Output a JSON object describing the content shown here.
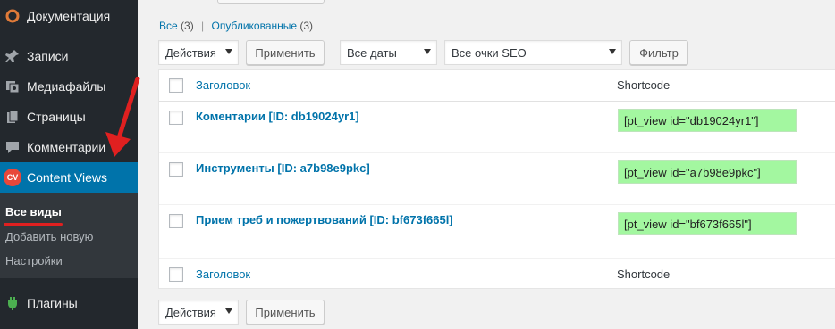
{
  "sidebar": {
    "items": [
      {
        "label": "Документация",
        "icon": "docs-logo-icon"
      },
      {
        "label": "Записи",
        "icon": "pin-icon"
      },
      {
        "label": "Медиафайлы",
        "icon": "media-icon"
      },
      {
        "label": "Страницы",
        "icon": "pages-icon"
      },
      {
        "label": "Комментарии",
        "icon": "comments-icon"
      },
      {
        "label": "Content Views",
        "icon": "cv-badge-icon",
        "badge": "CV"
      }
    ],
    "submenu": [
      "Все виды",
      "Добавить новую",
      "Настройки"
    ],
    "plugins": {
      "label": "Плагины",
      "icon": "plugins-icon"
    }
  },
  "views": {
    "all_label": "Все",
    "all_count": "(3)",
    "separator": "|",
    "published_label": "Опубликованные",
    "published_count": "(3)"
  },
  "toolbar": {
    "bulk_action": "Действия",
    "apply": "Применить",
    "date_filter": "Все даты",
    "seo_filter": "Все очки SEO",
    "filter": "Фильтр"
  },
  "table": {
    "headers": {
      "title": "Заголовок",
      "shortcode": "Shortcode"
    },
    "rows": [
      {
        "title": "Коментарии [ID: db19024yr1]",
        "shortcode": "[pt_view id=\"db19024yr1\"]"
      },
      {
        "title": "Инструменты [ID: a7b98e9pkc]",
        "shortcode": "[pt_view id=\"a7b98e9pkc\"]"
      },
      {
        "title": "Прием треб и пожертвований [ID: bf673f665l]",
        "shortcode": "[pt_view id=\"bf673f665l\"]"
      }
    ]
  },
  "bottom_toolbar": {
    "bulk_action": "Действия",
    "apply": "Применить"
  },
  "colors": {
    "sidebar_bg": "#23282d",
    "active": "#0073aa",
    "shortcode_bg": "#a3f7a0",
    "annotation": "#e02020"
  }
}
